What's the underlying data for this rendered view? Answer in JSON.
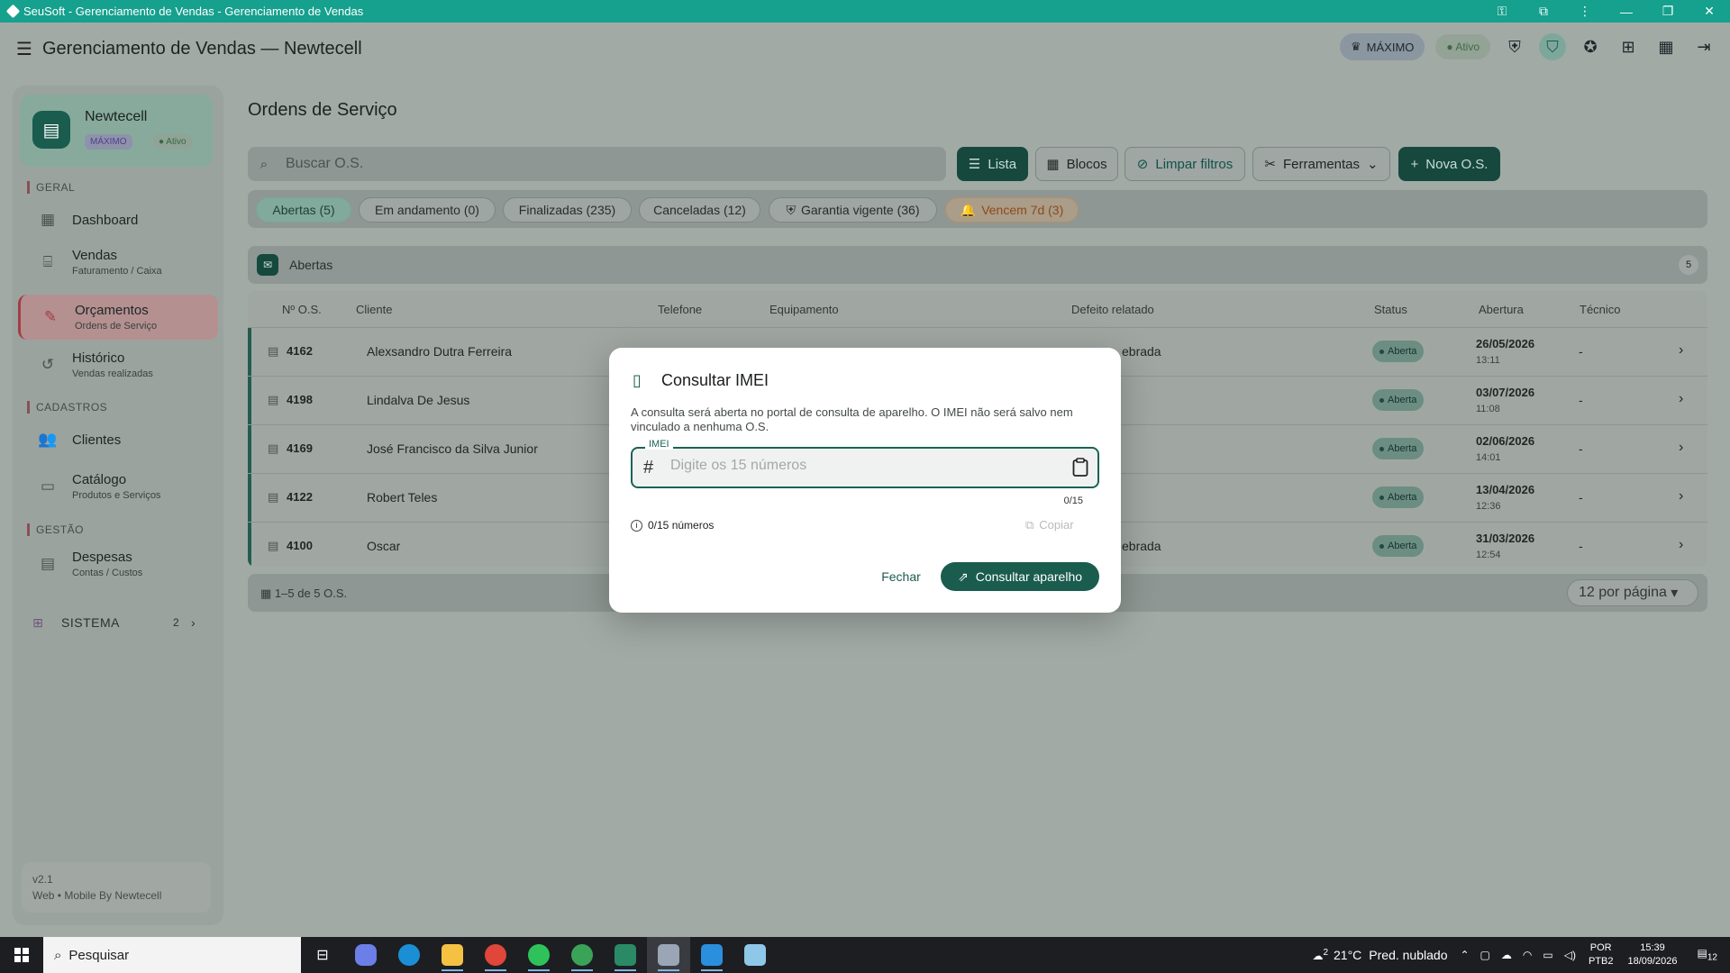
{
  "window": {
    "title": "SeuSoft - Gerenciamento de Vendas - Gerenciamento de Vendas"
  },
  "header": {
    "title": "Gerenciamento de Vendas — Newtecell",
    "plan_badge": "MÁXIMO",
    "status_badge": "Ativo"
  },
  "sidebar": {
    "store_name": "Newtecell",
    "store_plan": "MÁXIMO",
    "store_status": "Ativo",
    "sections": [
      "GERAL",
      "CADASTROS",
      "GESTÃO"
    ],
    "items": [
      {
        "label": "Dashboard",
        "sub": ""
      },
      {
        "label": "Vendas",
        "sub": "Faturamento / Caixa"
      },
      {
        "label": "Orçamentos",
        "sub": "Ordens de Serviço"
      },
      {
        "label": "Histórico",
        "sub": "Vendas realizadas"
      },
      {
        "label": "Clientes",
        "sub": ""
      },
      {
        "label": "Catálogo",
        "sub": "Produtos e Serviços"
      },
      {
        "label": "Despesas",
        "sub": "Contas / Custos"
      }
    ],
    "sistema": {
      "label": "SISTEMA",
      "count": "2"
    },
    "version": "v2.1",
    "footer": "Web • Mobile By Newtecell"
  },
  "main": {
    "title": "Ordens de Serviço",
    "search_placeholder": "Buscar O.S.",
    "buttons": {
      "lista": "Lista",
      "blocos": "Blocos",
      "limpar": "Limpar filtros",
      "ferramentas": "Ferramentas",
      "nova": "Nova O.S."
    },
    "filters": [
      "Abertas (5)",
      "Em andamento (0)",
      "Finalizadas (235)",
      "Canceladas (12)",
      "Garantia vigente (36)",
      "Vencem 7d (3)"
    ],
    "group": {
      "label": "Abertas",
      "count": "5"
    },
    "columns": [
      "Nº O.S.",
      "Cliente",
      "Telefone",
      "Equipamento",
      "Defeito relatado",
      "Status",
      "Abertura",
      "Técnico"
    ],
    "rows": [
      {
        "id": "4162",
        "cliente": "Alexsandro Dutra Ferreira",
        "defeito": "ebrada",
        "status": "Aberta",
        "data": "26/05/2026",
        "hora": "13:11",
        "tecnico": "-"
      },
      {
        "id": "4198",
        "cliente": "Lindalva De Jesus",
        "defeito": "",
        "status": "Aberta",
        "data": "03/07/2026",
        "hora": "11:08",
        "tecnico": "-"
      },
      {
        "id": "4169",
        "cliente": "José Francisco da Silva Junior",
        "defeito": "",
        "status": "Aberta",
        "data": "02/06/2026",
        "hora": "14:01",
        "tecnico": "-"
      },
      {
        "id": "4122",
        "cliente": "Robert Teles",
        "defeito": "",
        "status": "Aberta",
        "data": "13/04/2026",
        "hora": "12:36",
        "tecnico": "-"
      },
      {
        "id": "4100",
        "cliente": "Oscar",
        "defeito": "ebrada",
        "status": "Aberta",
        "data": "31/03/2026",
        "hora": "12:54",
        "tecnico": "-"
      }
    ],
    "footer": {
      "range": "1–5 de 5 O.S.",
      "per_page": "12 por página"
    }
  },
  "dialog": {
    "title": "Consultar IMEI",
    "description": "A consulta será aberta no portal de consulta de aparelho. O IMEI não será salvo nem vinculado a nenhuma O.S.",
    "field_label": "IMEI",
    "placeholder": "Digite os 15 números",
    "counter": "0/15",
    "helper": "0/15 números",
    "copy_label": "Copiar",
    "close_label": "Fechar",
    "submit_label": "Consultar aparelho"
  },
  "taskbar": {
    "search": "Pesquisar",
    "weather_temp": "21°C",
    "weather_text": "Pred. nublado",
    "lang1": "POR",
    "lang2": "PTB2",
    "time": "15:39",
    "date": "18/09/2026",
    "notif": "12",
    "weather_badge": "2"
  },
  "colors": {
    "accent": "#1a5c4e",
    "titlebar": "#16a08e",
    "scrim": "#a2aaa6"
  }
}
